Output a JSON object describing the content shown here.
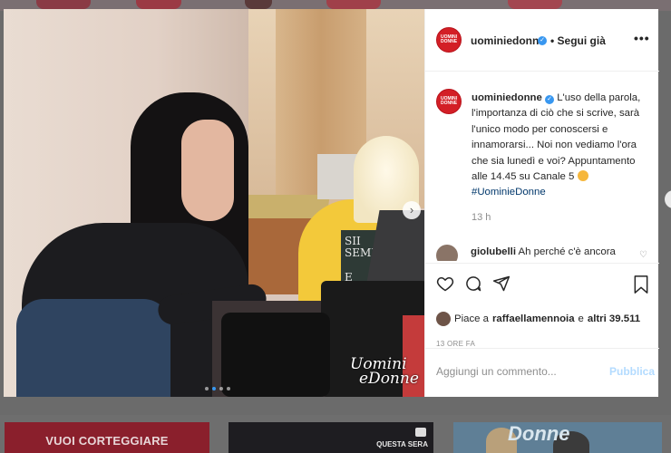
{
  "post": {
    "author": "uominiedonne",
    "follow_status": "• Segui già",
    "avatar_logo": "UOMINI DONNE",
    "caption": "L'uso della parola, l'importanza di ciò che si scrive, sarà l'unico modo per conoscersi e innamorarsi... Noi non vediamo l'ora che sia lunedì e voi? Appuntamento alle 14.45 su Canale 5",
    "hashtag": "#UominieDonne",
    "caption_time": "13 h",
    "comment": {
      "user": "giolubelli",
      "text": "Ah perché c'è ancora"
    },
    "likes": {
      "prefix": "Piace a",
      "user": "raffaellamennoia",
      "connector": "e",
      "others": "altri 39.511"
    },
    "timestamp": "13 ORE FA",
    "add_comment_placeholder": "Aggiungi un commento...",
    "publish_label": "Pubblica"
  },
  "photo": {
    "sign_text": [
      "SII SEMP",
      "E SEM"
    ],
    "logo_line1": "Uomini",
    "logo_line2": "eDonne",
    "carousel": {
      "count": 4,
      "active": 1
    }
  },
  "background": {
    "thumb1_text": "VUOI CORTEGGIARE",
    "thumb2_text": "QUESTA SERA",
    "thumb3_text": "Donne"
  },
  "icons": {
    "more": "more-options-icon",
    "like": "heart-icon",
    "comment": "comment-icon",
    "share": "share-icon",
    "save": "bookmark-icon",
    "next": "chevron-right-icon"
  },
  "colors": {
    "brand_red": "#d31f26",
    "verified_blue": "#3897f0",
    "hashtag": "#00376b",
    "publish_disabled": "#b3dbff"
  }
}
